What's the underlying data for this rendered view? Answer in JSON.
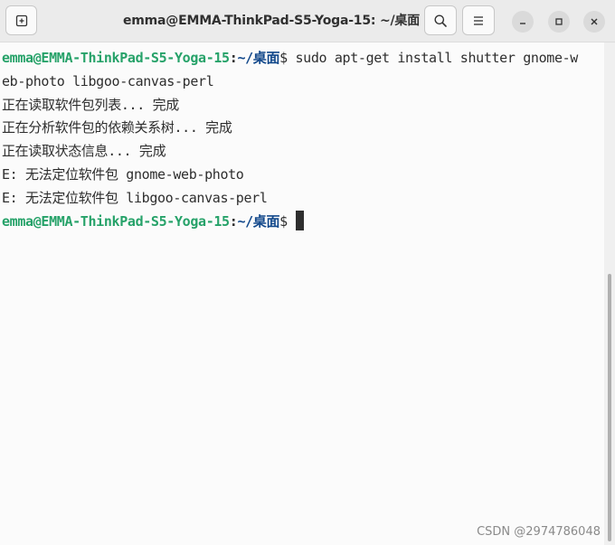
{
  "window": {
    "title": "emma@EMMA-ThinkPad-S5-Yoga-15: ~/桌面"
  },
  "icons": {
    "new_tab": "new-tab-icon",
    "search": "search-icon",
    "menu": "hamburger-menu-icon",
    "minimize": "minimize-icon",
    "maximize": "maximize-icon",
    "close": "close-icon"
  },
  "prompt": {
    "user_host": "emma@EMMA-ThinkPad-S5-Yoga-15",
    "sep": ":",
    "path": "~/桌面",
    "dollar": "$"
  },
  "terminal": {
    "command_line1": " sudo apt-get install shutter gnome-w",
    "command_line2": "eb-photo libgoo-canvas-perl",
    "output": [
      "正在读取软件包列表... 完成",
      "正在分析软件包的依赖关系树... 完成",
      "正在读取状态信息... 完成",
      "E: 无法定位软件包 gnome-web-photo",
      "E: 无法定位软件包 libgoo-canvas-perl"
    ]
  },
  "watermark": "CSDN @2974786048",
  "colors": {
    "prompt_user": "#26a269",
    "prompt_path": "#12488b",
    "text": "#2e2e2e",
    "background": "#fbfbfb"
  }
}
